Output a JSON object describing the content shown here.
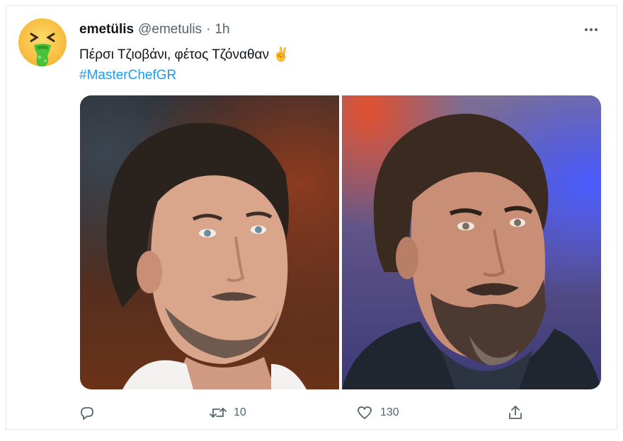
{
  "tweet": {
    "author_name": "emetülis",
    "author_handle": "@emetulis",
    "separator": "·",
    "timestamp": "1h",
    "text": "Πέρσι Τζιοβάνι, φέτος Τζόναθαν ✌️",
    "hashtag": "#MasterChefGR",
    "avatar_icon": "nauseated-face-emoji",
    "more_icon": "more-horizontal-icon",
    "media": [
      {
        "description_icon": "photo-man-long-hair-beard"
      },
      {
        "description_icon": "photo-man-beard-purple-background"
      }
    ],
    "actions": {
      "reply": {
        "icon": "reply-icon",
        "count": ""
      },
      "retweet": {
        "icon": "retweet-icon",
        "count": "10"
      },
      "like": {
        "icon": "heart-icon",
        "count": "130"
      },
      "share": {
        "icon": "share-icon",
        "count": ""
      }
    }
  },
  "colors": {
    "link": "#1d9bf0",
    "secondary_text": "#536471",
    "primary_text": "#0f1419"
  }
}
